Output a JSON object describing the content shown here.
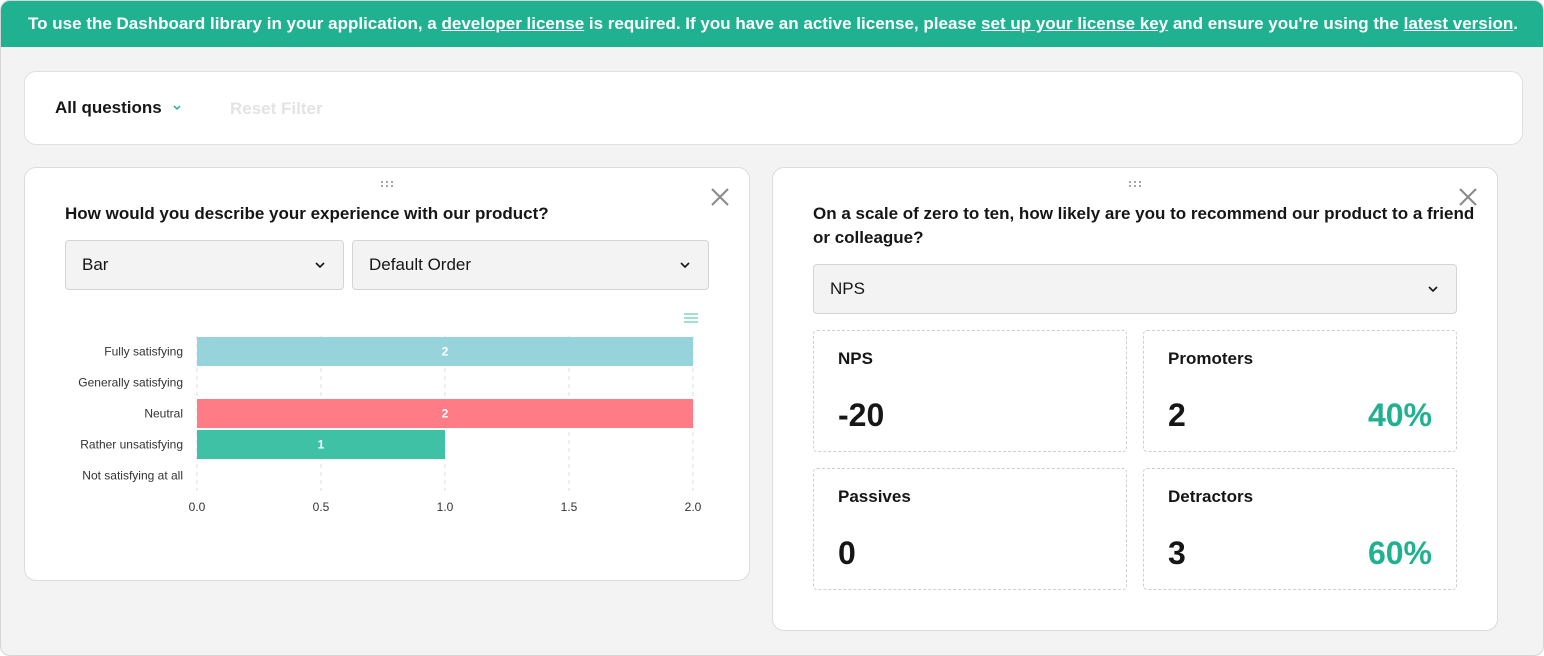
{
  "banner": {
    "t1": "To use the Dashboard library in your application, a ",
    "link1": "developer license",
    "t2": " is required. If you have an active license, please ",
    "link2": "set up your license key",
    "t3": " and ensure you're using the ",
    "link3": "latest version",
    "t4": "."
  },
  "toolbar": {
    "filter_label": "All questions",
    "reset_label": "Reset Filter"
  },
  "colors": {
    "accent": "#1fb190",
    "bar_blue": "#97d3db",
    "bar_red": "#ff7b86",
    "bar_green": "#3fc1a5"
  },
  "icons": {
    "drag": "drag-handle-icon",
    "close": "close-icon",
    "chevron": "chevron-down-icon",
    "menu": "hamburger-menu-icon"
  },
  "left_panel": {
    "question": "How would you describe your experience with our product?",
    "chart_type": "Bar",
    "order": "Default Order"
  },
  "chart_data": {
    "type": "bar",
    "orientation": "horizontal",
    "categories": [
      "Fully satisfying",
      "Generally satisfying",
      "Neutral",
      "Rather unsatisfying",
      "Not satisfying at all"
    ],
    "values": [
      2,
      0,
      2,
      1,
      0
    ],
    "value_labels": [
      "2",
      "",
      "2",
      "1",
      ""
    ],
    "colors": [
      "#97d3db",
      null,
      "#ff7b86",
      "#3fc1a5",
      null
    ],
    "xlim": [
      0,
      2
    ],
    "xticks": [
      "0.0",
      "0.5",
      "1.0",
      "1.5",
      "2.0"
    ],
    "grid": true,
    "title": "",
    "xlabel": "",
    "ylabel": ""
  },
  "right_panel": {
    "question_line1": "On a scale of zero to ten, how likely are you to recommend our product to a friend",
    "question_line2": "or colleague?",
    "view": "NPS",
    "stats": {
      "nps": {
        "label": "NPS",
        "value": "-20"
      },
      "promoters": {
        "label": "Promoters",
        "value": "2",
        "percent": "40%"
      },
      "passives": {
        "label": "Passives",
        "value": "0"
      },
      "detractors": {
        "label": "Detractors",
        "value": "3",
        "percent": "60%"
      }
    }
  }
}
